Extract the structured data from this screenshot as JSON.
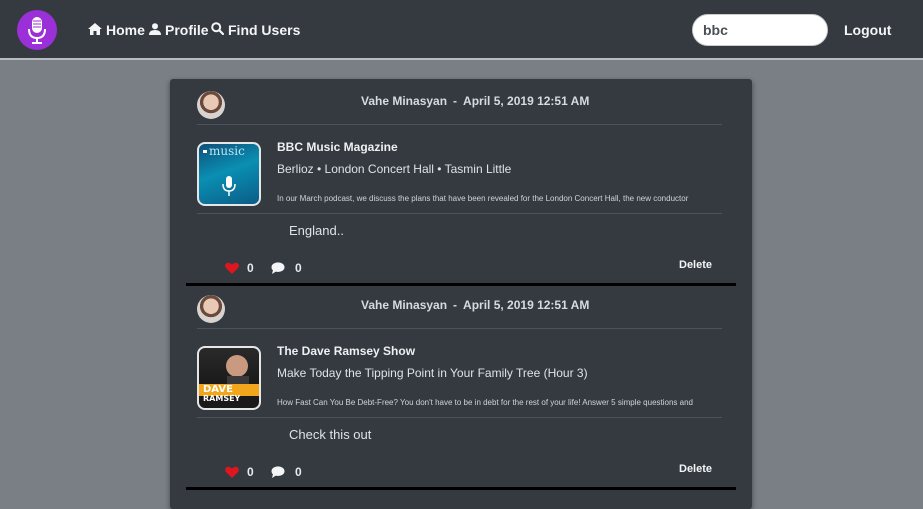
{
  "nav": {
    "home_label": "Home",
    "profile_label": "Profile",
    "find_users_label": "Find Users",
    "logout_label": "Logout",
    "search_value": "bbc",
    "logo_color": "#9b30d9"
  },
  "posts": [
    {
      "author": "Vahe Minasyan",
      "separator": "-",
      "timestamp": "April 5, 2019 12:51 AM",
      "podcast_title": "BBC Music Magazine",
      "episode_title": "Berlioz • London Concert Hall • Tasmin Little",
      "description": "In our March podcast, we discuss the plans that have been revealed for the London Concert Hall, the new conductor",
      "text": "England..",
      "likes": "0",
      "comments": "0",
      "delete_label": "Delete"
    },
    {
      "author": "Vahe Minasyan",
      "separator": "-",
      "timestamp": "April 5, 2019 12:51 AM",
      "podcast_title": "The Dave Ramsey Show",
      "episode_title": "Make Today the Tipping Point in Your Family Tree (Hour 3)",
      "description": "How Fast Can You Be Debt-Free? You don't have to be in debt for the rest of your life! Answer 5 simple questions and",
      "text": "Check this out",
      "likes": "0",
      "comments": "0",
      "delete_label": "Delete"
    }
  ],
  "covers": {
    "bbc_text": "music",
    "ramsey_line1": "DAVE",
    "ramsey_line2": "RAMSEY"
  },
  "colors": {
    "heart": "#e0161f",
    "navbar": "#343a40",
    "page_bg": "#7a7f86"
  }
}
